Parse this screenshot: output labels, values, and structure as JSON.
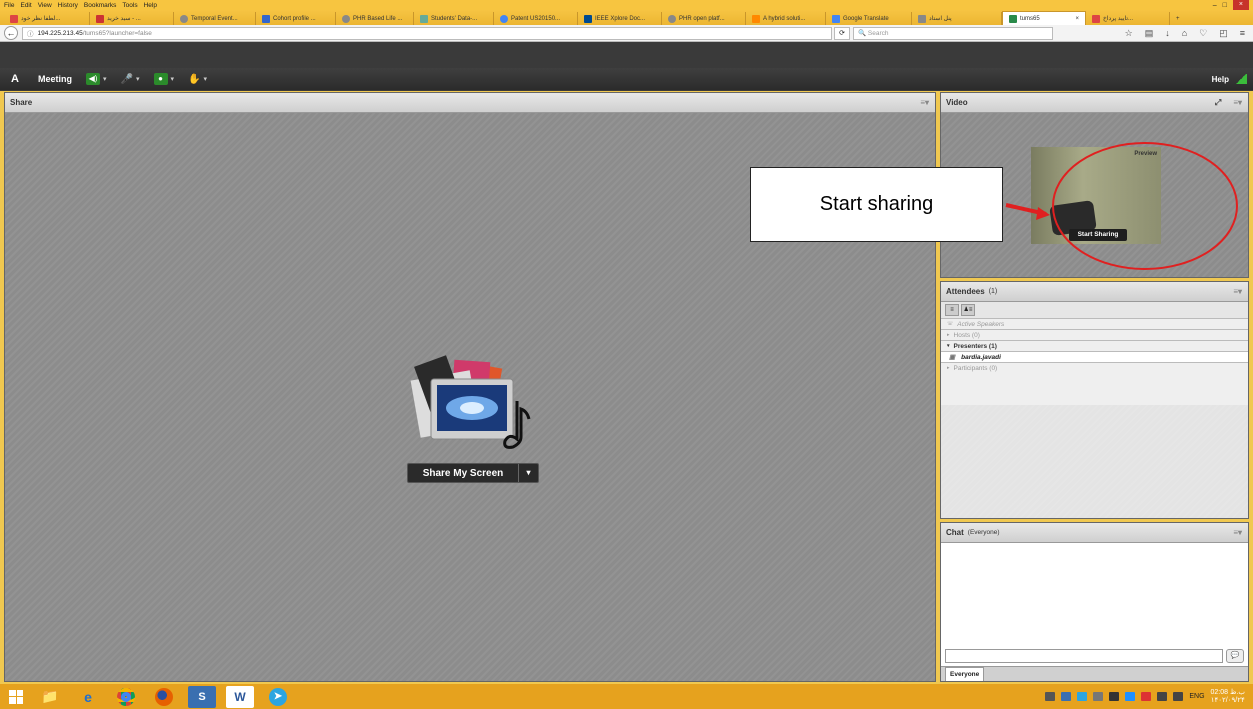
{
  "browser": {
    "menu": [
      "File",
      "Edit",
      "View",
      "History",
      "Bookmarks",
      "Tools",
      "Help"
    ],
    "tabs": [
      "لطفا نظر خود...",
      "سید خرید - ...",
      "Temporal Event...",
      "Cohort profile ...",
      "PHR Based Life ...",
      "Students' Data-...",
      "Patent US20150...",
      "IEEE Xplore Doc...",
      "PHR open platf...",
      "A hybrid soluti...",
      "Google Translate",
      "پنل استاد",
      "tums65",
      "تایید پرداخ..."
    ],
    "active_tab_index": 12,
    "url_host": "194.225.213.45",
    "url_path": "/tums65?launcher=false",
    "search_placeholder": "Search",
    "window_controls": {
      "minimize": "–",
      "maximize": "□",
      "close": "×"
    },
    "new_tab": "+"
  },
  "connect": {
    "logo": "A",
    "meeting_menu": "Meeting",
    "help_menu": "Help",
    "toolbar_icons": [
      "speaker-icon",
      "microphone-icon",
      "webcam-icon",
      "raise-hand-icon"
    ]
  },
  "share_pod": {
    "title": "Share",
    "button_label": "Share My Screen",
    "button_arrow": "▾"
  },
  "video_pod": {
    "title": "Video",
    "preview_label": "Preview",
    "start_sharing_label": "Start Sharing"
  },
  "attendees_pod": {
    "title": "Attendees",
    "count": "(1)",
    "active_speakers": "Active Speakers",
    "hosts": "Hosts (0)",
    "presenters": "Presenters (1)",
    "presenter_name": "bardia.javadi",
    "participants": "Participants (0)"
  },
  "chat_pod": {
    "title": "Chat",
    "scope": "(Everyone)",
    "tab_label": "Everyone"
  },
  "annotation": {
    "callout_text": "Start sharing",
    "arrow_color": "#e02020",
    "ellipse_color": "#e02020"
  },
  "taskbar": {
    "apps": [
      "file-explorer-icon",
      "internet-explorer-icon",
      "chrome-icon",
      "firefox-icon",
      "skype-icon",
      "word-icon",
      "telegram-icon"
    ],
    "language": "ENG",
    "time": "02:08 ب.ظ",
    "date": "۱۴۰۲/۰۹/۲۴"
  },
  "colors": {
    "firefox_chrome": "#f7c540",
    "connect_bar": "#2e2e2e",
    "pod_bg": "#8c8c8c",
    "taskbar": "#e6a21e"
  }
}
